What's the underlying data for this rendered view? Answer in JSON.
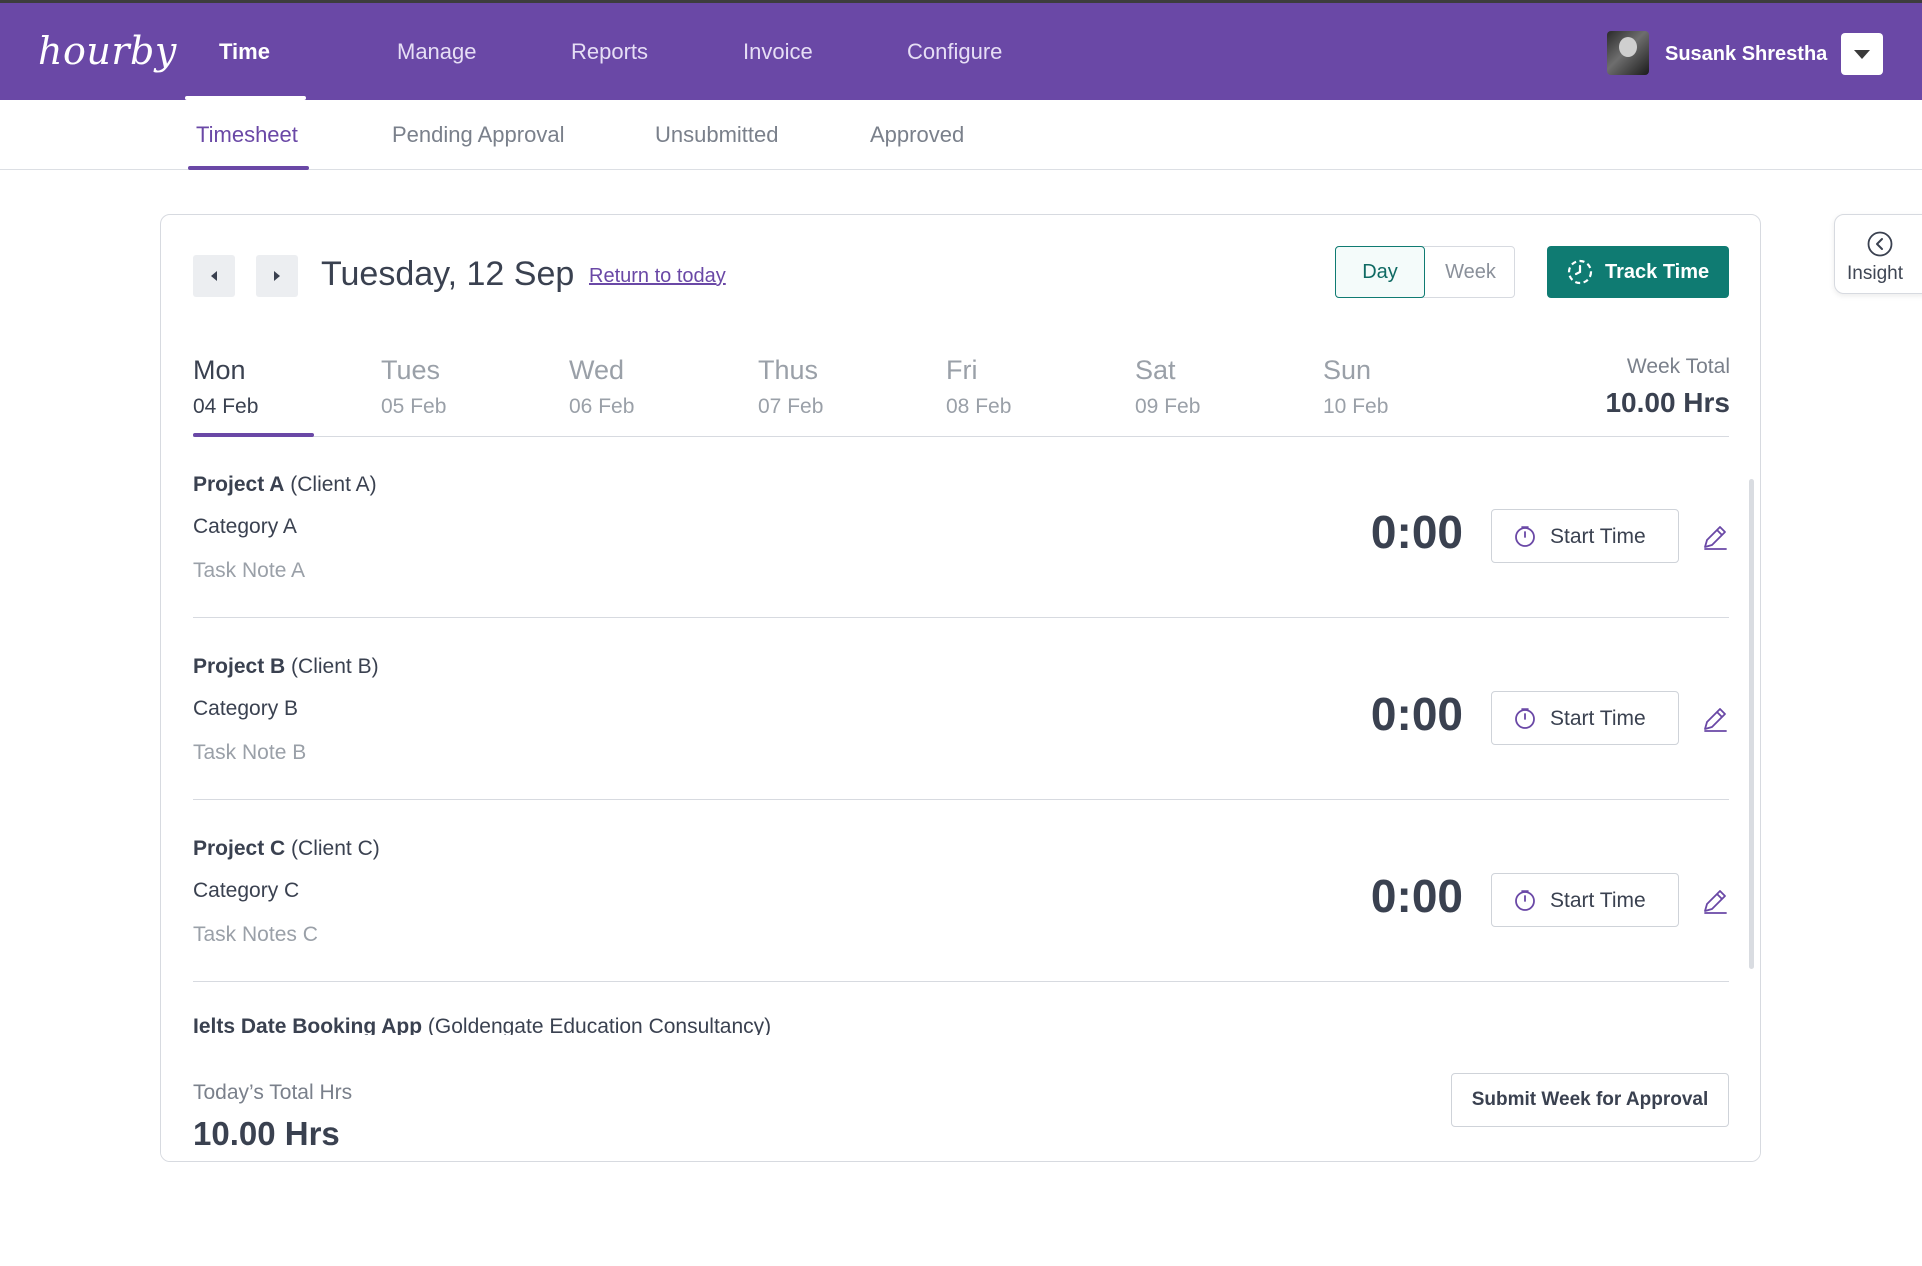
{
  "app": {
    "logo": "hourby"
  },
  "nav": {
    "items": [
      {
        "label": "Time",
        "active": true
      },
      {
        "label": "Manage"
      },
      {
        "label": "Reports"
      },
      {
        "label": "Invoice"
      },
      {
        "label": "Configure"
      }
    ]
  },
  "user": {
    "name": "Susank Shrestha",
    "avatar_icon": "user-avatar",
    "dropdown_icon": "caret-down-icon"
  },
  "subtabs": [
    {
      "label": "Timesheet",
      "active": true
    },
    {
      "label": "Pending Approval"
    },
    {
      "label": "Unsubmitted"
    },
    {
      "label": "Approved"
    }
  ],
  "insight": {
    "label": "Insight",
    "icon": "chevron-left-circle-icon"
  },
  "header": {
    "date_title": "Tuesday, 12 Sep",
    "return_link": "Return to today",
    "view_toggle": {
      "day": "Day",
      "week": "Week",
      "selected": "Day"
    },
    "track_time": "Track Time"
  },
  "days": [
    {
      "name": "Mon",
      "date": "04 Feb",
      "active": true
    },
    {
      "name": "Tues",
      "date": "05 Feb"
    },
    {
      "name": "Wed",
      "date": "06 Feb"
    },
    {
      "name": "Thus",
      "date": "07 Feb"
    },
    {
      "name": "Fri",
      "date": "08 Feb"
    },
    {
      "name": "Sat",
      "date": "09 Feb"
    },
    {
      "name": "Sun",
      "date": "10 Feb"
    }
  ],
  "week_total": {
    "label": "Week Total",
    "value": "10.00 Hrs"
  },
  "entries": [
    {
      "project": "Project A",
      "client": "(Client A)",
      "category": "Category A",
      "note": "Task Note A",
      "time": "0:00",
      "button": "Start Time"
    },
    {
      "project": "Project B",
      "client": "(Client B)",
      "category": "Category B",
      "note": "Task Note B",
      "time": "0:00",
      "button": "Start Time"
    },
    {
      "project": "Project C",
      "client": "(Client C)",
      "category": "Category C",
      "note": "Task Notes C",
      "time": "0:00",
      "button": "Start Time"
    }
  ],
  "partial_entry": {
    "project": "Ielts Date Booking App",
    "client": "(Goldengate Education Consultancy)"
  },
  "footer": {
    "today_label": "Today’s Total Hrs",
    "today_value": "10.00 Hrs",
    "submit": "Submit Week for Approval"
  },
  "colors": {
    "brand_purple": "#6a48a6",
    "accent_teal": "#0f7b72",
    "text_dark": "#3a4150",
    "text_muted": "#9aa0a8"
  }
}
